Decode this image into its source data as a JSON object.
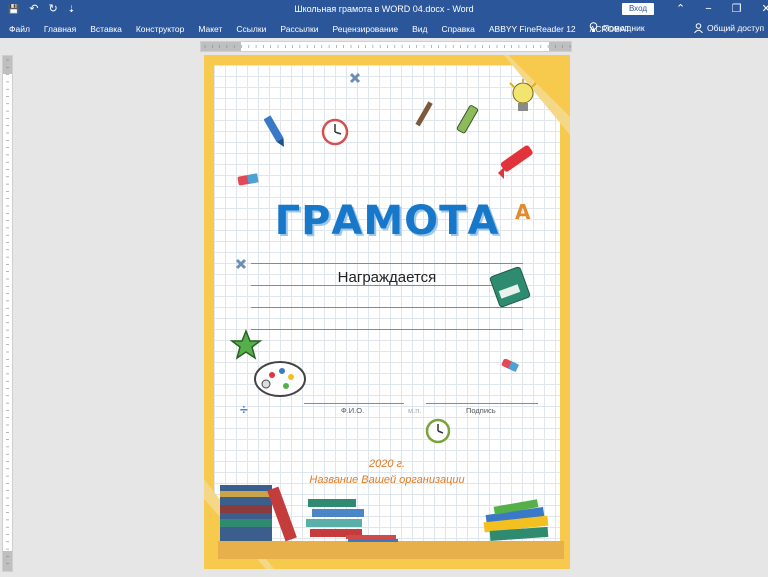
{
  "window": {
    "title": "Школьная грамота в WORD 04.docx  -  Word",
    "signin": "Вход",
    "qat_save": "💾",
    "qat_undo": "↶",
    "qat_redo": "↻",
    "qat_customize": "⇣",
    "btn_min": "−",
    "btn_restore": "❐",
    "btn_close": "✕",
    "collapse": "⌃"
  },
  "menu": {
    "tabs": [
      "Файл",
      "Главная",
      "Вставка",
      "Конструктор",
      "Макет",
      "Ссылки",
      "Рассылки",
      "Рецензирование",
      "Вид",
      "Справка",
      "ABBYY FineReader 12",
      "ACROBAT"
    ],
    "help": "Помощник",
    "share": "Общий доступ"
  },
  "document": {
    "title": "ГРАМОТА",
    "subtitle": "Награждается",
    "fio_label": "Ф.И.О.",
    "mp_label": "м.п.",
    "signature_label": "Подпись",
    "year": "2020 г.",
    "org": "Название Вашей организации"
  },
  "colors": {
    "accent": "#2b579a",
    "title": "#1777c9",
    "frame": "#f7c94c",
    "footer_text": "#e07a22"
  }
}
